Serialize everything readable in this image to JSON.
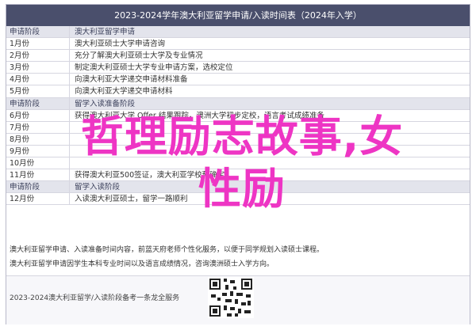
{
  "header": {
    "title": "2023-2024学年澳大利亚留学申请/入读时间表（2024年入学）"
  },
  "rows": [
    {
      "kind": "section",
      "time": "申请阶段",
      "content": "澳大利亚留学申请"
    },
    {
      "kind": "item",
      "time": "1月份",
      "content": "澳大利亚硕士大学申请咨询"
    },
    {
      "kind": "item",
      "time": "2月份",
      "content": "充分了解澳大利亚硕士大学及专业情况"
    },
    {
      "kind": "item",
      "time": "3月份",
      "content": "制定澳大利亚硕士大学专业申请方案，选校定位"
    },
    {
      "kind": "item",
      "time": "4月份",
      "content": "向澳大利亚大学递交申请材料准备"
    },
    {
      "kind": "item",
      "time": "5月份",
      "content": "向澳大利亚大学递交申请材料"
    },
    {
      "kind": "section",
      "time": "申请阶段",
      "content": "留学入读准备阶段"
    },
    {
      "kind": "item",
      "time": "6月份",
      "content": "获得澳大利亚大学 Offer 结果跟踪，澳洲大学初步定校，语言考试成绩准备"
    },
    {
      "kind": "item",
      "time": "7月份",
      "content": ""
    },
    {
      "kind": "item",
      "time": "8月份",
      "content": ""
    },
    {
      "kind": "item",
      "time": "9月份",
      "content": ""
    },
    {
      "kind": "item",
      "time": "10月份",
      "content": ""
    },
    {
      "kind": "item",
      "time": "11月份",
      "content": "获得澳大利亚500签证，澳大利亚学校预确定"
    },
    {
      "kind": "section",
      "time": "申请阶段",
      "content": "留学入读阶段"
    },
    {
      "kind": "item",
      "time": "12月份",
      "content": "入读澳大利亚硕士，留学一路顺利"
    }
  ],
  "notes": {
    "line1": "澳大利亚留学申请、入读准备时间内容，前蓝天府老师个性化服务，以便于同学规划入读硕士课程。",
    "line2": "澳大利亚留学申请因学生本科专业时间以及语言成绩情况，咨询澳洲硕士入学方向。"
  },
  "footer": {
    "text": "2023-2024澳大利亚留学/入读阶段备考一条龙全服务"
  },
  "overlay": {
    "line1": "哲理励志故事,女",
    "line2": "性励"
  }
}
